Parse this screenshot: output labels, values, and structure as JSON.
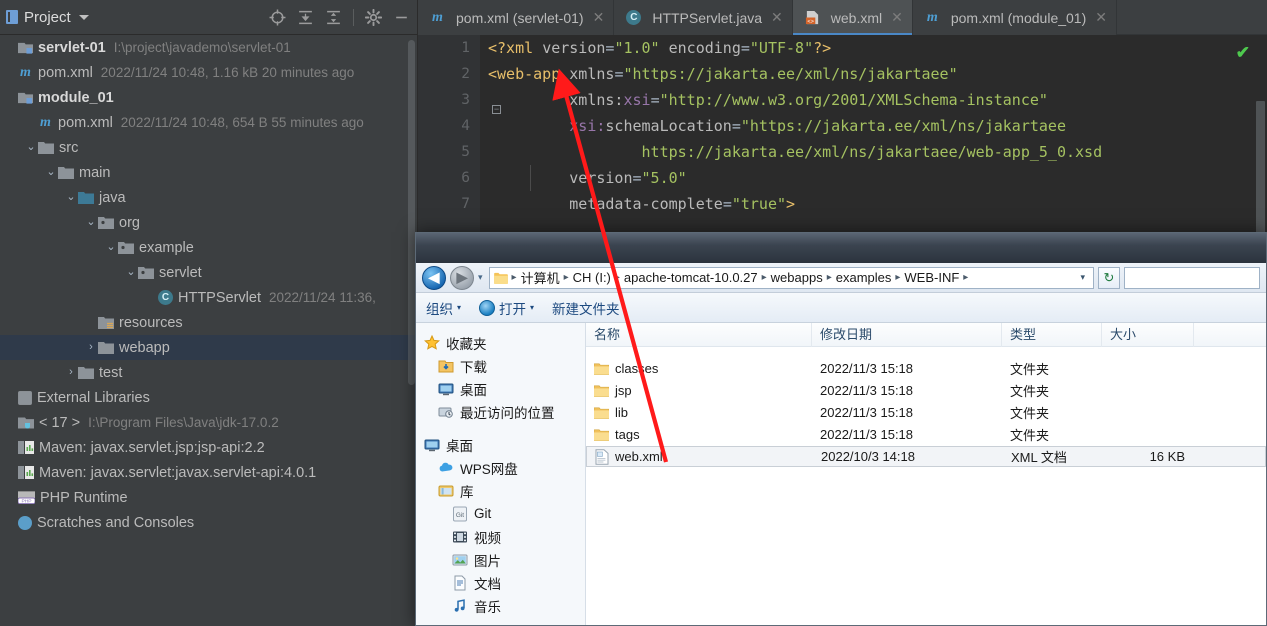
{
  "ide": {
    "project_panel": {
      "title": "Project",
      "tools": [
        {
          "name": "locate-icon",
          "label": "Select Opened File"
        },
        {
          "name": "expand-all-icon",
          "label": "Expand All"
        },
        {
          "name": "collapse-all-icon",
          "label": "Collapse All"
        },
        {
          "name": "settings-gear-icon",
          "label": "Options"
        },
        {
          "name": "minimize-icon",
          "label": "Hide"
        }
      ],
      "tree": [
        {
          "id": "servlet-01",
          "label": "servlet-01",
          "meta": "I:\\project\\javademo\\servlet-01",
          "icon": "module-icon",
          "indent": 0,
          "arrow": "",
          "bold": true
        },
        {
          "id": "pom-root",
          "label": "pom.xml",
          "meta": "2022/11/24 10:48, 1.16 kB 20 minutes ago",
          "icon": "maven-icon",
          "indent": 0,
          "arrow": "",
          "bold": false
        },
        {
          "id": "module_01",
          "label": "module_01",
          "meta": "",
          "icon": "module-icon",
          "indent": 0,
          "arrow": "",
          "bold": true
        },
        {
          "id": "pom-module",
          "label": "pom.xml",
          "meta": "2022/11/24 10:48, 654 B 55 minutes ago",
          "icon": "maven-icon",
          "indent": 1,
          "arrow": "",
          "bold": false
        },
        {
          "id": "src",
          "label": "src",
          "meta": "",
          "icon": "folder-icon",
          "indent": 1,
          "arrow": "v",
          "bold": false
        },
        {
          "id": "main",
          "label": "main",
          "meta": "",
          "icon": "folder-icon",
          "indent": 2,
          "arrow": "v",
          "bold": false
        },
        {
          "id": "java",
          "label": "java",
          "meta": "",
          "icon": "folder-source-icon",
          "indent": 3,
          "arrow": "v",
          "bold": false
        },
        {
          "id": "org",
          "label": "org",
          "meta": "",
          "icon": "package-icon",
          "indent": 4,
          "arrow": "v",
          "bold": false
        },
        {
          "id": "example",
          "label": "example",
          "meta": "",
          "icon": "package-icon",
          "indent": 5,
          "arrow": "v",
          "bold": false
        },
        {
          "id": "servlet",
          "label": "servlet",
          "meta": "",
          "icon": "package-icon",
          "indent": 6,
          "arrow": "v",
          "bold": false
        },
        {
          "id": "HTTPServlet",
          "label": "HTTPServlet",
          "meta": "2022/11/24 11:36,",
          "icon": "java-class-icon",
          "indent": 7,
          "arrow": "",
          "bold": false
        },
        {
          "id": "resources",
          "label": "resources",
          "meta": "",
          "icon": "folder-resources-icon",
          "indent": 4,
          "arrow": "",
          "bold": false
        },
        {
          "id": "webapp",
          "label": "webapp",
          "meta": "",
          "icon": "folder-icon",
          "indent": 4,
          "arrow": ">",
          "bold": false,
          "selected": true
        },
        {
          "id": "test",
          "label": "test",
          "meta": "",
          "icon": "folder-icon",
          "indent": 3,
          "arrow": ">",
          "bold": false
        }
      ],
      "libraries_header": "External Libraries",
      "libraries": [
        {
          "id": "jdk",
          "label": "< 17 >",
          "meta": "I:\\Program Files\\Java\\jdk-17.0.2",
          "icon": "jdk-icon"
        },
        {
          "id": "jsp-api",
          "label": "Maven: javax.servlet.jsp:jsp-api:2.2",
          "meta": "",
          "icon": "maven-library-icon"
        },
        {
          "id": "servlet-api",
          "label": "Maven: javax.servlet:javax.servlet-api:4.0.1",
          "meta": "",
          "icon": "maven-library-icon"
        },
        {
          "id": "php-runtime",
          "label": "PHP Runtime",
          "meta": "",
          "icon": "php-icon"
        }
      ],
      "scratches": "Scratches and Consoles"
    },
    "editor": {
      "tabs": [
        {
          "id": "pom-servlet01",
          "label": "pom.xml (servlet-01)",
          "icon": "maven-file-icon",
          "active": false
        },
        {
          "id": "httpservlet-java",
          "label": "HTTPServlet.java",
          "icon": "java-class-icon",
          "active": false
        },
        {
          "id": "web-xml",
          "label": "web.xml",
          "icon": "xml-file-icon",
          "active": true
        },
        {
          "id": "pom-module01",
          "label": "pom.xml (module_01)",
          "icon": "maven-file-icon",
          "active": false
        }
      ],
      "line_numbers": [
        "1",
        "2",
        "3",
        "4",
        "5",
        "6",
        "7"
      ],
      "code": [
        {
          "n": 1,
          "segments": [
            {
              "t": "pi",
              "s": "<?xml "
            },
            {
              "t": "attr",
              "s": "version"
            },
            {
              "t": "punct",
              "s": "="
            },
            {
              "t": "val",
              "s": "\"1.0\""
            },
            {
              "t": "attr",
              "s": " encoding"
            },
            {
              "t": "punct",
              "s": "="
            },
            {
              "t": "val",
              "s": "\"UTF-8\""
            },
            {
              "t": "pi",
              "s": "?>"
            }
          ]
        },
        {
          "n": 2,
          "segments": [
            {
              "t": "tag",
              "s": "<web-app "
            },
            {
              "t": "attr",
              "s": "xmlns"
            },
            {
              "t": "punct",
              "s": "="
            },
            {
              "t": "val",
              "s": "\"https://jakarta.ee/xml/ns/jakartaee\""
            }
          ]
        },
        {
          "n": 3,
          "segments": [
            {
              "t": "plain",
              "s": "         "
            },
            {
              "t": "attr",
              "s": "xmlns:"
            },
            {
              "t": "ns",
              "s": "xsi"
            },
            {
              "t": "punct",
              "s": "="
            },
            {
              "t": "val",
              "s": "\"http://www.w3.org/2001/XMLSchema-instance\""
            }
          ]
        },
        {
          "n": 4,
          "segments": [
            {
              "t": "plain",
              "s": "         "
            },
            {
              "t": "ns",
              "s": "xsi:"
            },
            {
              "t": "attr",
              "s": "schemaLocation"
            },
            {
              "t": "punct",
              "s": "="
            },
            {
              "t": "val",
              "s": "\"https://jakarta.ee/xml/ns/jakartaee"
            }
          ]
        },
        {
          "n": 5,
          "segments": [
            {
              "t": "plain",
              "s": "                 "
            },
            {
              "t": "val",
              "s": "https://jakarta.ee/xml/ns/jakartaee/web-app_5_0.xsd"
            }
          ]
        },
        {
          "n": 6,
          "segments": [
            {
              "t": "plain",
              "s": "         "
            },
            {
              "t": "attr",
              "s": "version"
            },
            {
              "t": "punct",
              "s": "="
            },
            {
              "t": "val",
              "s": "\"5.0\""
            }
          ]
        },
        {
          "n": 7,
          "segments": [
            {
              "t": "plain",
              "s": "         "
            },
            {
              "t": "attr",
              "s": "metadata-complete"
            },
            {
              "t": "punct",
              "s": "="
            },
            {
              "t": "val",
              "s": "\"true\""
            },
            {
              "t": "tag",
              "s": ">"
            }
          ]
        }
      ],
      "inspection_status": "✔",
      "fold_marker": "−"
    },
    "colors": {
      "panel_bg": "#3c3f41",
      "editor_bg": "#2b2b2b",
      "selection": "#2f3a4a",
      "tab_active": "#4e5254",
      "accent": "#4a88c7",
      "string": "#a5c261",
      "tag": "#e8bf6a",
      "namespace": "#9876aa",
      "ok_green": "#4ec94e"
    }
  },
  "explorer": {
    "title": "",
    "nav": {
      "back_label": "◀",
      "forward_label": "▶",
      "dropdown_label": "▾",
      "refresh_label": "↻",
      "breadcrumb": [
        "计算机",
        "CH (I:)",
        "apache-tomcat-10.0.27",
        "webapps",
        "examples",
        "WEB-INF"
      ],
      "breadcrumb_separator": "▸",
      "search_placeholder": ""
    },
    "toolbar": [
      {
        "id": "organize",
        "label": "组织",
        "caret": "▾",
        "icon": ""
      },
      {
        "id": "open",
        "label": "打开",
        "caret": "▾",
        "icon": "ie-icon"
      },
      {
        "id": "new-folder",
        "label": "新建文件夹",
        "caret": "",
        "icon": ""
      }
    ],
    "sidebar": [
      {
        "id": "favorites",
        "label": "收藏夹",
        "icon": "star-icon",
        "level": 0
      },
      {
        "id": "downloads",
        "label": "下载",
        "icon": "download-icon",
        "level": 1
      },
      {
        "id": "desktop-fav",
        "label": "桌面",
        "icon": "desktop-icon",
        "level": 1
      },
      {
        "id": "recent-places",
        "label": "最近访问的位置",
        "icon": "recent-icon",
        "level": 1
      },
      {
        "id": "gap1",
        "label": "",
        "icon": "gap",
        "level": 0
      },
      {
        "id": "desktop",
        "label": "桌面",
        "icon": "desktop-icon",
        "level": 0
      },
      {
        "id": "wps-cloud",
        "label": "WPS网盘",
        "icon": "cloud-icon",
        "level": 1
      },
      {
        "id": "libraries",
        "label": "库",
        "icon": "library-icon",
        "level": 1
      },
      {
        "id": "git",
        "label": "Git",
        "icon": "git-icon",
        "level": 2
      },
      {
        "id": "videos",
        "label": "视频",
        "icon": "video-icon",
        "level": 2
      },
      {
        "id": "pictures",
        "label": "图片",
        "icon": "picture-icon",
        "level": 2
      },
      {
        "id": "documents",
        "label": "文档",
        "icon": "document-icon",
        "level": 2
      },
      {
        "id": "music",
        "label": "音乐",
        "icon": "music-icon",
        "level": 2
      }
    ],
    "columns": [
      "名称",
      "修改日期",
      "类型",
      "大小"
    ],
    "files": [
      {
        "name": "classes",
        "date": "2022/11/3 15:18",
        "type": "文件夹",
        "size": "",
        "icon": "folder-icon",
        "selected": false
      },
      {
        "name": "jsp",
        "date": "2022/11/3 15:18",
        "type": "文件夹",
        "size": "",
        "icon": "folder-icon",
        "selected": false
      },
      {
        "name": "lib",
        "date": "2022/11/3 15:18",
        "type": "文件夹",
        "size": "",
        "icon": "folder-icon",
        "selected": false
      },
      {
        "name": "tags",
        "date": "2022/11/3 15:18",
        "type": "文件夹",
        "size": "",
        "icon": "folder-icon",
        "selected": false
      },
      {
        "name": "web.xml",
        "date": "2022/10/3 14:18",
        "type": "XML 文档",
        "size": "16 KB",
        "icon": "xml-file-icon",
        "selected": true
      }
    ]
  },
  "annotation": {
    "arrow_color": "#ff1a1a",
    "description": "red-arrow-from-web-xml-to-web-app-tag"
  }
}
